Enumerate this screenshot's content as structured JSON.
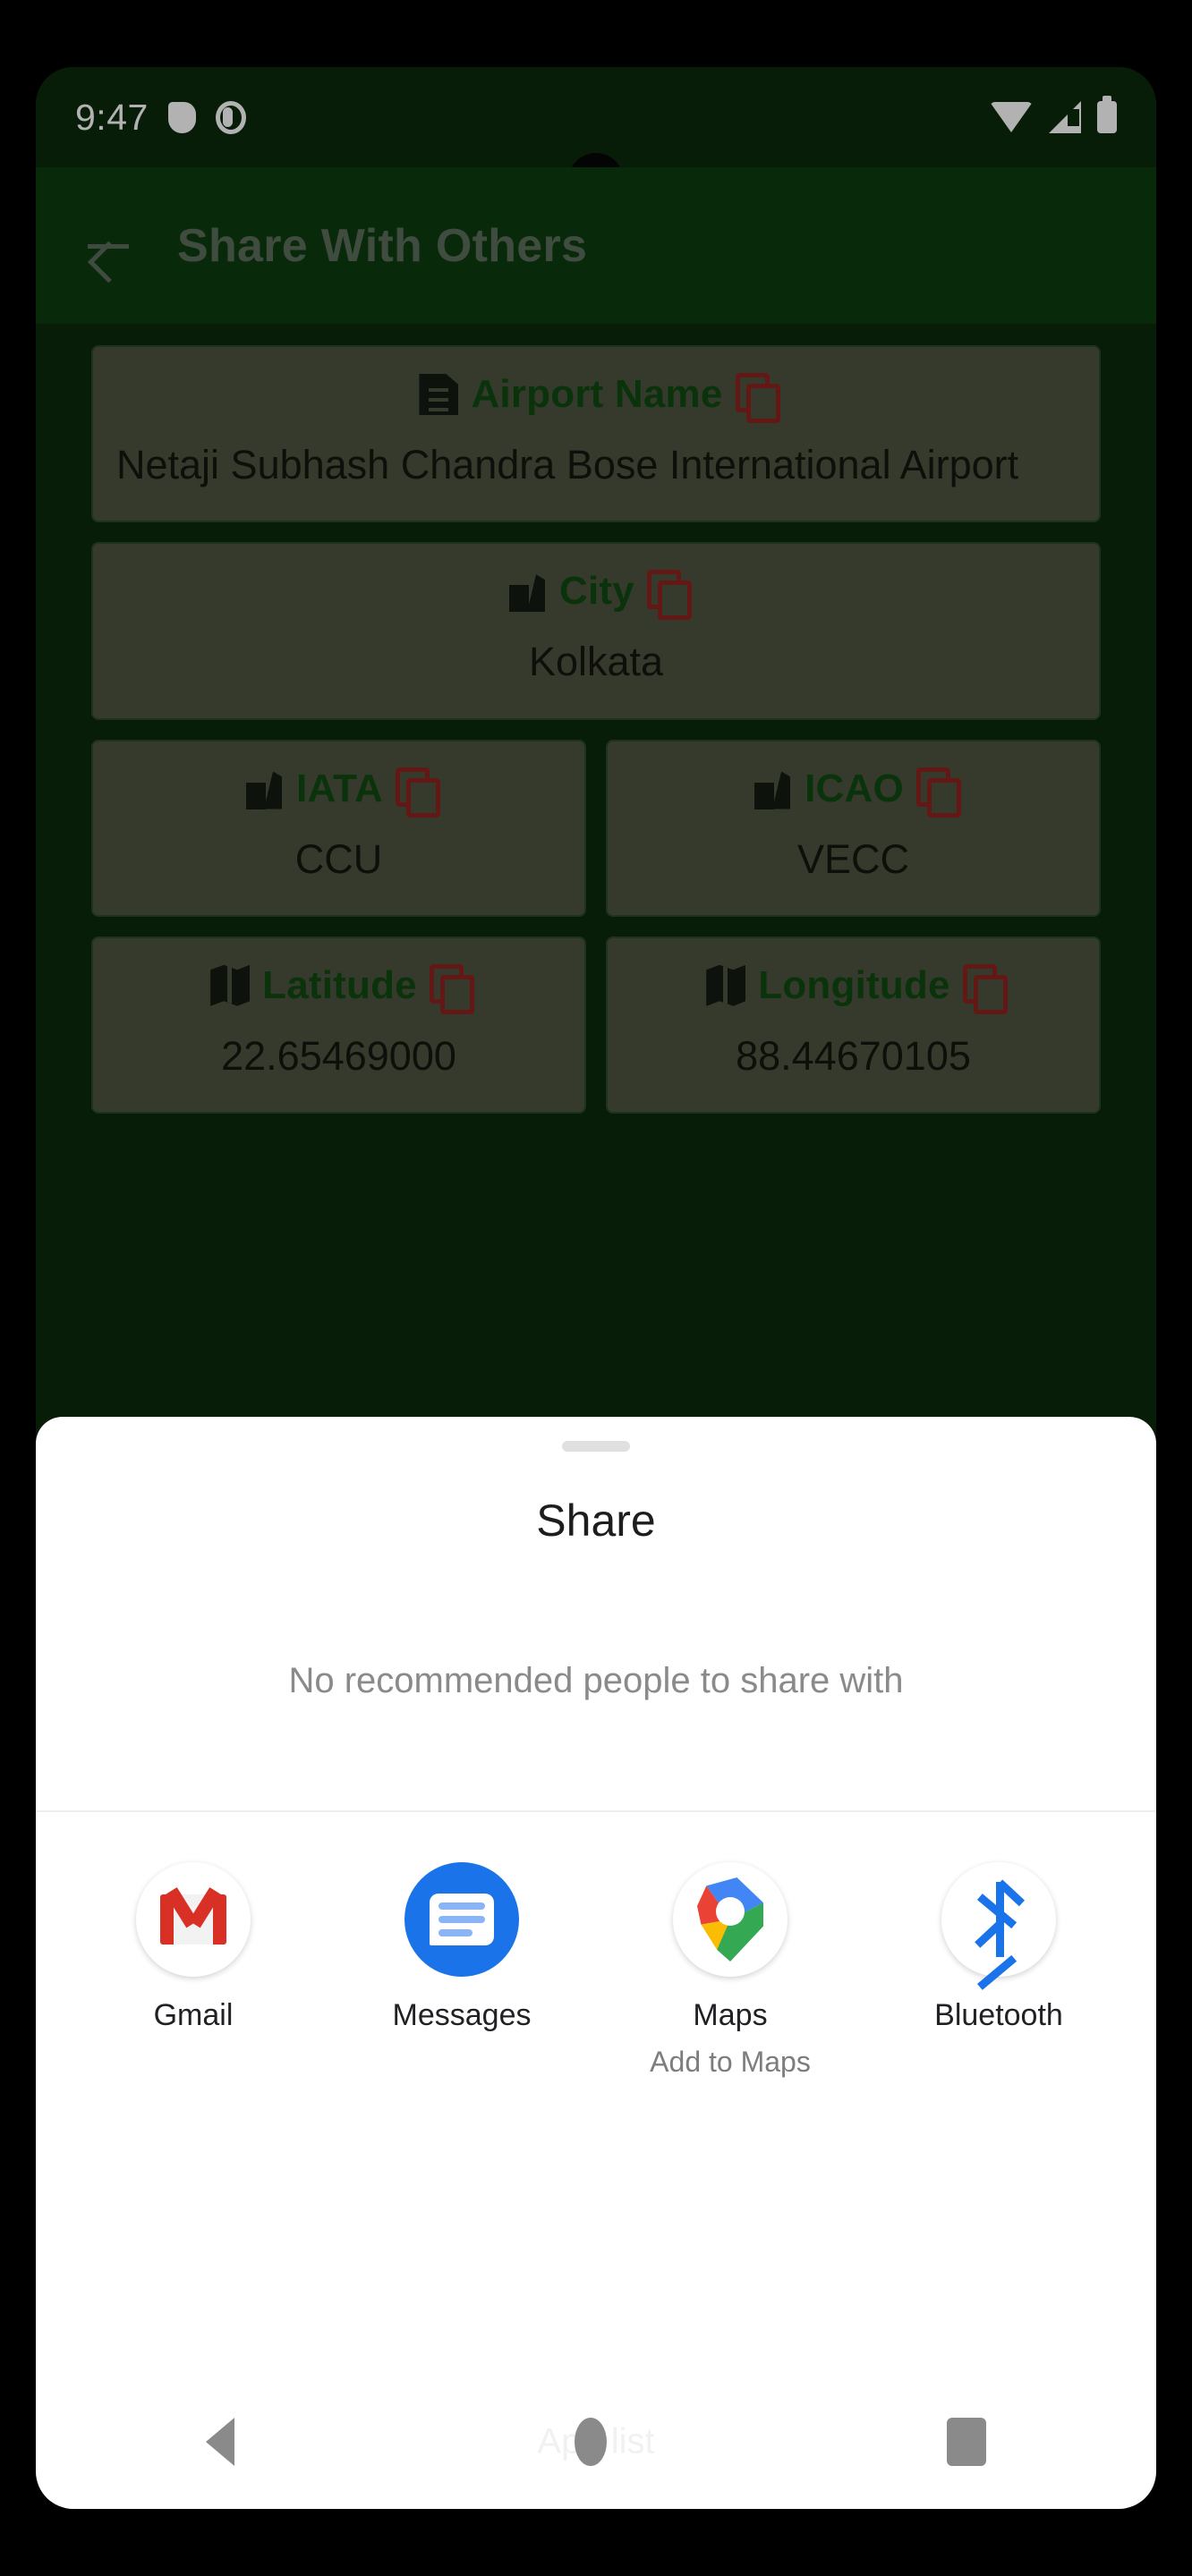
{
  "status_bar": {
    "time": "9:47",
    "icons": [
      "shield-icon",
      "contrast-icon",
      "wifi-icon",
      "cellular-signal-icon",
      "battery-icon"
    ]
  },
  "app_bar": {
    "back_label": "back-arrow",
    "title": "Share With Others"
  },
  "details": {
    "cards": [
      {
        "label": "Airport Name",
        "value": "Netaji Subhash Chandra Bose International Airport",
        "icon": "document-icon",
        "align": "left",
        "full_width": true
      },
      {
        "label": "City",
        "value": "Kolkata",
        "icon": "building-icon",
        "align": "center",
        "full_width": true
      },
      {
        "label": "IATA",
        "value": "CCU",
        "icon": "building-icon",
        "align": "center",
        "full_width": false
      },
      {
        "label": "ICAO",
        "value": "VECC",
        "icon": "building-icon",
        "align": "center",
        "full_width": false
      },
      {
        "label": "Latitude",
        "value": "22.65469000",
        "icon": "map-icon",
        "align": "center",
        "full_width": false
      },
      {
        "label": "Longitude",
        "value": "88.44670105",
        "icon": "map-icon",
        "align": "center",
        "full_width": false
      }
    ],
    "copy_icon": "copy-icon"
  },
  "share_sheet": {
    "title": "Share",
    "empty_message": "No recommended people to share with",
    "apps": [
      {
        "label": "Gmail",
        "sub": "",
        "icon": "gmail-icon"
      },
      {
        "label": "Messages",
        "sub": "",
        "icon": "messages-icon"
      },
      {
        "label": "Maps",
        "sub": "Add to Maps",
        "icon": "maps-icon"
      },
      {
        "label": "Bluetooth",
        "sub": "",
        "icon": "bluetooth-icon"
      }
    ]
  },
  "nav_bar": {
    "ghost_text": "App list",
    "back": "back-nav-icon",
    "home": "home-nav-icon",
    "recents": "recents-nav-icon"
  },
  "colors": {
    "app_bar_green": "#0d3c10",
    "label_green": "#0f4a11",
    "copy_red": "#8f2320",
    "accent_blue": "#1a73e8"
  }
}
